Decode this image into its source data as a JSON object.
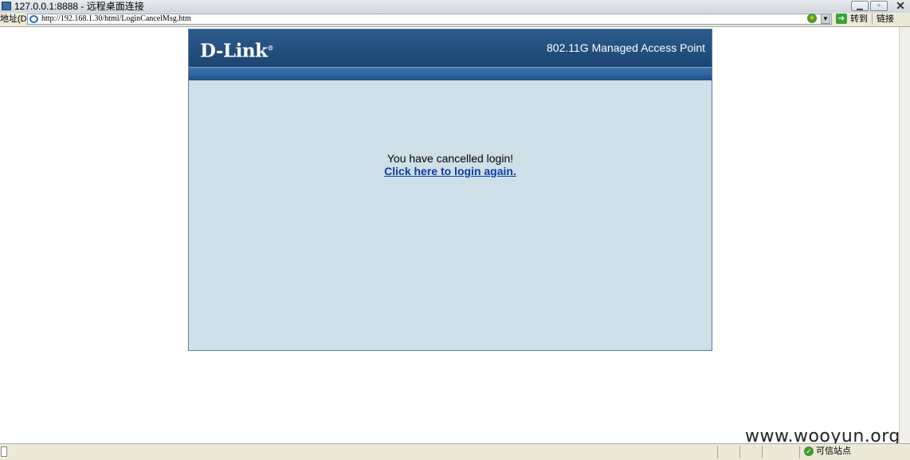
{
  "window": {
    "title": "127.0.0.1:8888 - 远程桌面连接"
  },
  "addressbar": {
    "label": "地址(D)",
    "url": "http://192.168.1.30/html/LoginCancelMsg.htm",
    "go_label": "转到",
    "links_label": "链接"
  },
  "page": {
    "logo": "D-Link",
    "logo_mark": "®",
    "product": "802.11G Managed Access Point",
    "message": "You have cancelled login!",
    "link_text": "Click here to login again."
  },
  "statusbar": {
    "zone": "可信站点"
  },
  "watermark": "www.wooyun.org"
}
